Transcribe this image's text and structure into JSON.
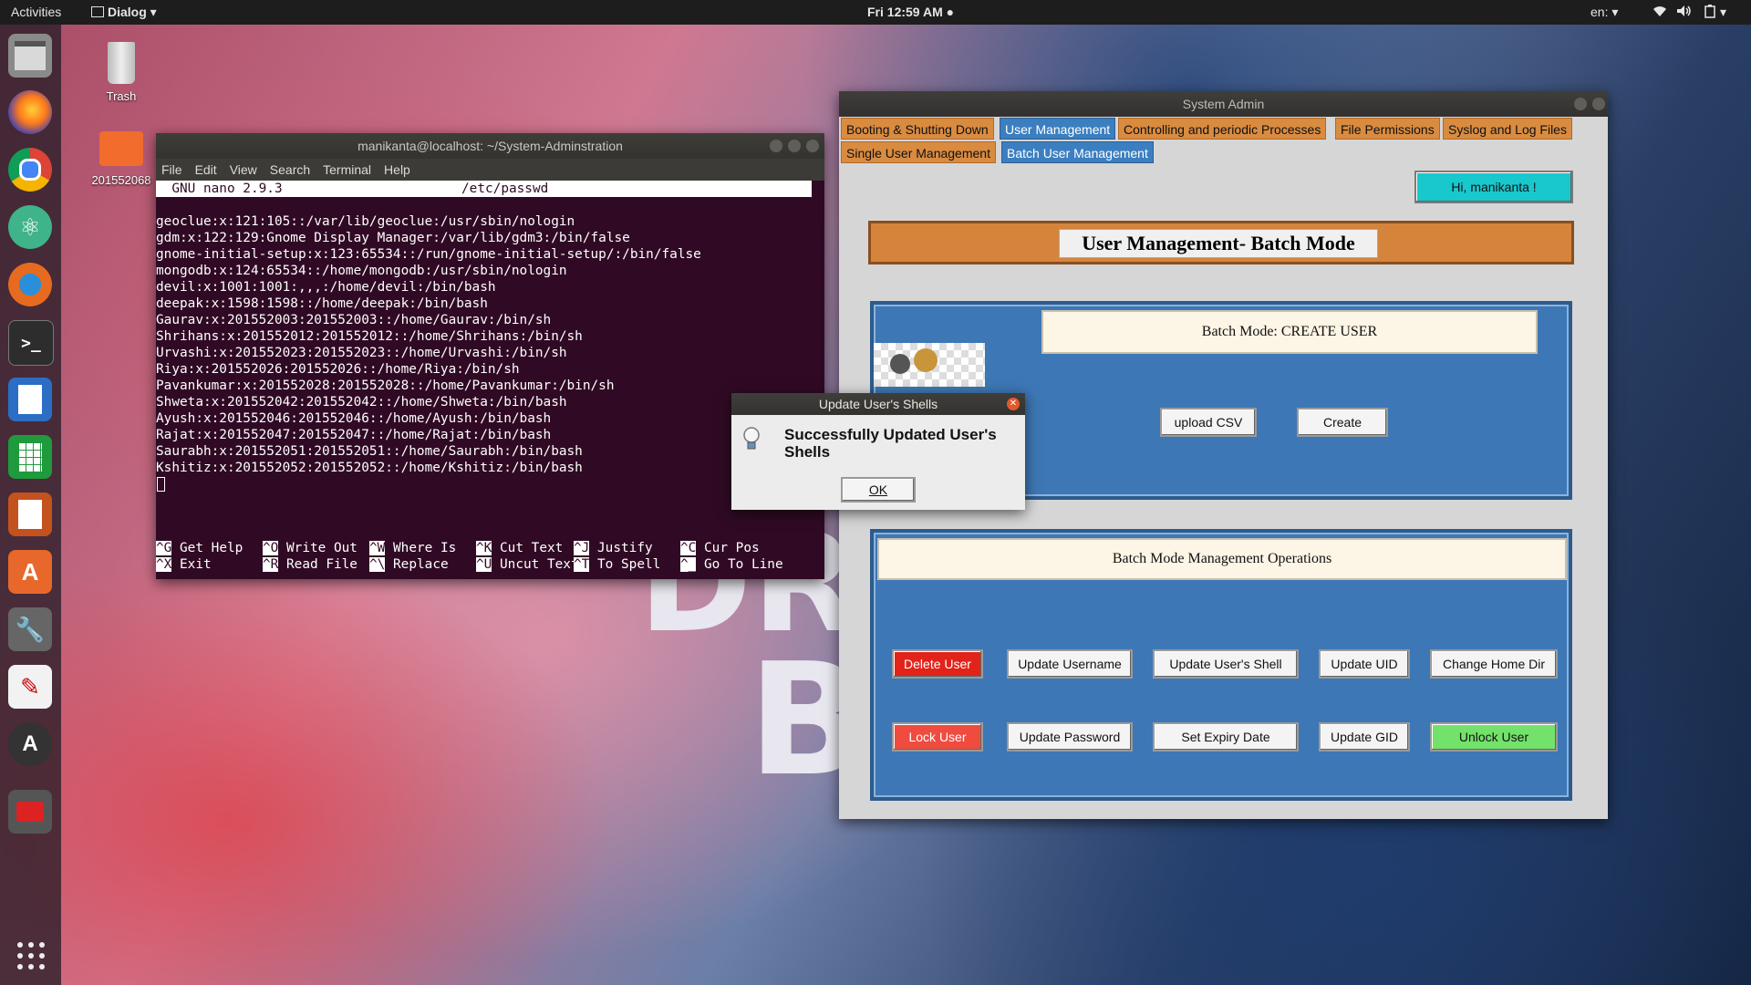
{
  "topbar": {
    "activities": "Activities",
    "app_menu": "Dialog",
    "clock": "Fri 12:59 AM",
    "lang": "en"
  },
  "desktop": {
    "trash_label": "Trash",
    "folder_label": "201552068"
  },
  "wallpaper_text": {
    "line1": "DR",
    "line2": "B"
  },
  "terminal": {
    "title": "manikanta@localhost: ~/System-Adminstration",
    "menu": [
      "File",
      "Edit",
      "View",
      "Search",
      "Terminal",
      "Help"
    ],
    "nano_version": "  GNU nano 2.9.3",
    "nano_file": "/etc/passwd",
    "lines": [
      "geoclue:x:121:105::/var/lib/geoclue:/usr/sbin/nologin",
      "gdm:x:122:129:Gnome Display Manager:/var/lib/gdm3:/bin/false",
      "gnome-initial-setup:x:123:65534::/run/gnome-initial-setup/:/bin/false",
      "mongodb:x:124:65534::/home/mongodb:/usr/sbin/nologin",
      "devil:x:1001:1001:,,,:/home/devil:/bin/bash",
      "deepak:x:1598:1598::/home/deepak:/bin/bash",
      "Gaurav:x:201552003:201552003::/home/Gaurav:/bin/sh",
      "Shrihans:x:201552012:201552012::/home/Shrihans:/bin/sh",
      "Urvashi:x:201552023:201552023::/home/Urvashi:/bin/sh",
      "Riya:x:201552026:201552026::/home/Riya:/bin/sh",
      "Pavankumar:x:201552028:201552028::/home/Pavankumar:/bin/sh",
      "Shweta:x:201552042:201552042::/home/Shweta:/bin/bash",
      "Ayush:x:201552046:201552046::/home/Ayush:/bin/bash",
      "Rajat:x:201552047:201552047::/home/Rajat:/bin/bash",
      "Saurabh:x:201552051:201552051::/home/Saurabh:/bin/bash",
      "Kshitiz:x:201552052:201552052::/home/Kshitiz:/bin/bash"
    ],
    "help_row1": [
      {
        "key": "^G",
        "label": "Get Help"
      },
      {
        "key": "^O",
        "label": "Write Out"
      },
      {
        "key": "^W",
        "label": "Where Is"
      },
      {
        "key": "^K",
        "label": "Cut Text"
      },
      {
        "key": "^J",
        "label": "Justify"
      },
      {
        "key": "^C",
        "label": "Cur Pos"
      }
    ],
    "help_row2": [
      {
        "key": "^X",
        "label": "Exit"
      },
      {
        "key": "^R",
        "label": "Read File"
      },
      {
        "key": "^\\",
        "label": "Replace"
      },
      {
        "key": "^U",
        "label": "Uncut Text"
      },
      {
        "key": "^T",
        "label": "To Spell"
      },
      {
        "key": "^_",
        "label": "Go To Line"
      }
    ]
  },
  "sysadmin": {
    "title": "System Admin",
    "tabs": [
      "Booting & Shutting Down",
      "User Management",
      "Controlling and periodic Processes",
      "File Permissions",
      "Syslog and Log Files"
    ],
    "subtabs": [
      "Single User Management",
      "Batch User Management"
    ],
    "greeting": "Hi, manikanta !",
    "heading": "User Management- Batch Mode",
    "create_label": "Batch Mode:  CREATE USER",
    "upload_btn": "upload CSV",
    "create_btn": "Create",
    "ops_label": "Batch Mode Management Operations",
    "ops_row1": [
      "Delete User",
      "Update Username",
      "Update User's Shell",
      "Update UID",
      "Change Home Dir"
    ],
    "ops_row2": [
      "Lock User",
      "Update Password",
      "Set Expiry Date",
      "Update GID",
      "Unlock User"
    ]
  },
  "dialog": {
    "title": "Update User's Shells",
    "message": "Successfully Updated User's Shells",
    "ok": "OK"
  },
  "colors": {
    "tab_orange": "#d98b40",
    "tab_selected": "#3b7fc0",
    "panel_blue": "#3d77b5",
    "greeting_cyan": "#18c8cc",
    "terminal_bg": "#300a24"
  }
}
